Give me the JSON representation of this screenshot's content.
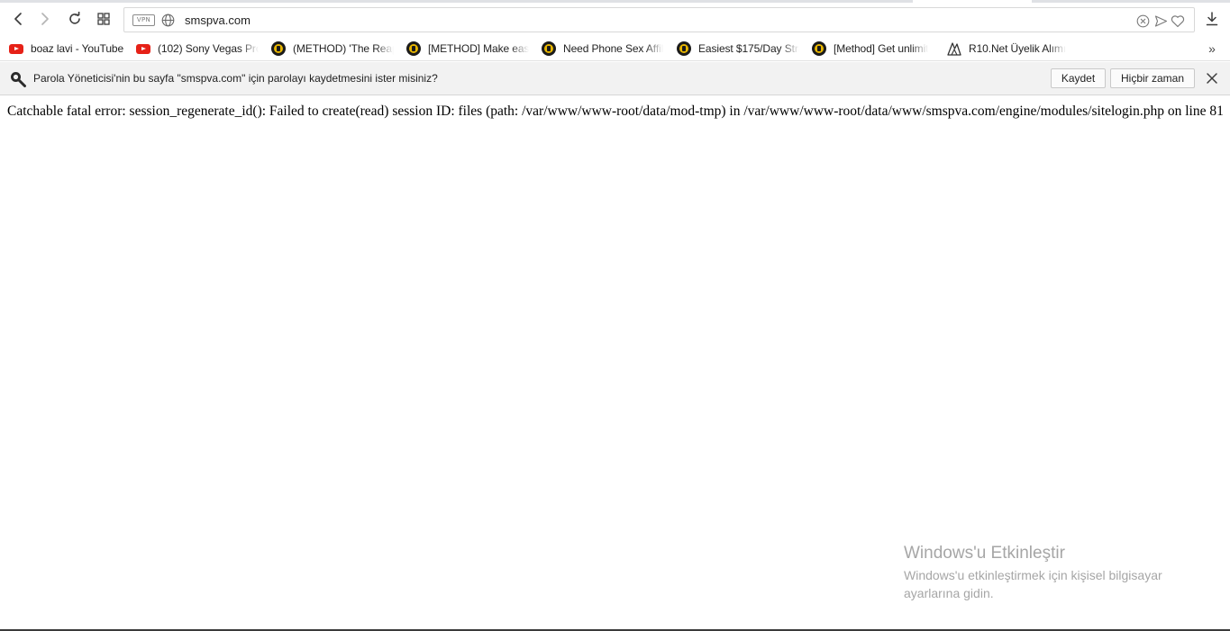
{
  "browser": {
    "address_bar": {
      "vpn_badge": "VPN",
      "url": "smspva.com"
    },
    "icons": {
      "back": "back-arrow-icon",
      "forward": "forward-arrow-icon",
      "reload": "reload-icon",
      "speed_dial": "grid-icon",
      "globe": "globe-icon",
      "snapshot": "snapshot-icon",
      "send": "send-icon",
      "heart": "heart-icon",
      "download": "download-icon"
    }
  },
  "bookmarks": {
    "items": [
      {
        "label": "boaz lavi - YouTube",
        "icon": "youtube-icon"
      },
      {
        "label": "(102) Sony Vegas Pro",
        "icon": "youtube-icon"
      },
      {
        "label": "(METHOD) 'The Reap",
        "icon": "blackhatworld-icon"
      },
      {
        "label": "[METHOD] Make eas",
        "icon": "blackhatworld-icon"
      },
      {
        "label": "Need Phone Sex Affil",
        "icon": "blackhatworld-icon"
      },
      {
        "label": "Easiest $175/Day Stra",
        "icon": "blackhatworld-icon"
      },
      {
        "label": "[Method] Get unlimit",
        "icon": "blackhatworld-icon"
      },
      {
        "label": "R10.Net Üyelik Alımı",
        "icon": "r10-icon"
      }
    ],
    "more": "»"
  },
  "infobar": {
    "message": "Parola Yöneticisi'nin bu sayfa \"smspva.com\" için parolayı kaydetmesini ister misiniz?",
    "save_label": "Kaydet",
    "never_label": "Hiçbir zaman"
  },
  "page": {
    "error_text": "Catchable fatal error: session_regenerate_id(): Failed to create(read) session ID: files (path: /var/www/www-root/data/mod-tmp) in /var/www/www-root/data/www/smspva.com/engine/modules/sitelogin.php on line 81"
  },
  "watermark": {
    "title": "Windows'u Etkinleştir",
    "subtitle": "Windows'u etkinleştirmek için kişisel bilgisayar ayarlarına gidin."
  },
  "colors": {
    "youtube_red": "#e62117",
    "bhw_gold": "#e8b600",
    "infobar_bg": "#f2f2f2",
    "watermark": "#a6a6a6"
  }
}
